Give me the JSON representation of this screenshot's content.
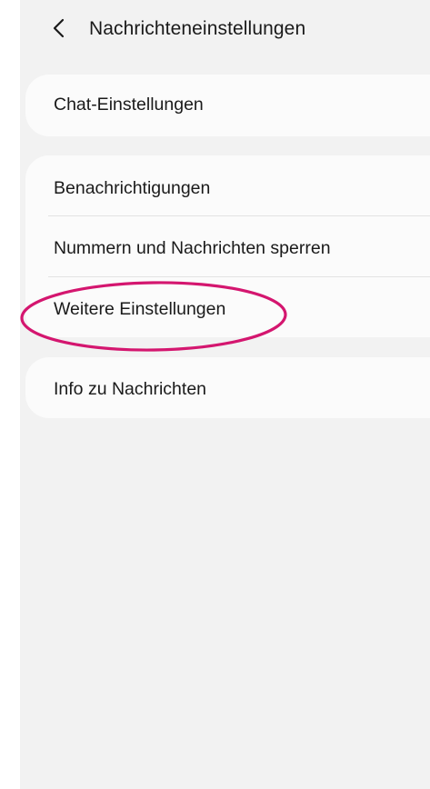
{
  "header": {
    "back_icon": "chevron-left-icon",
    "title": "Nachrichteneinstellungen"
  },
  "groups": [
    {
      "items": [
        {
          "label": "Chat-Einstellungen"
        }
      ]
    },
    {
      "items": [
        {
          "label": "Benachrichtigungen"
        },
        {
          "label": "Nummern und Nachrichten sperren"
        },
        {
          "label": "Weitere Einstellungen",
          "highlighted": true
        }
      ]
    },
    {
      "items": [
        {
          "label": "Info zu Nachrichten"
        }
      ]
    }
  ],
  "colors": {
    "background": "#f2f2f2",
    "card": "#fbfbfb",
    "text": "#1a1a1a",
    "highlight": "#d4166f"
  }
}
